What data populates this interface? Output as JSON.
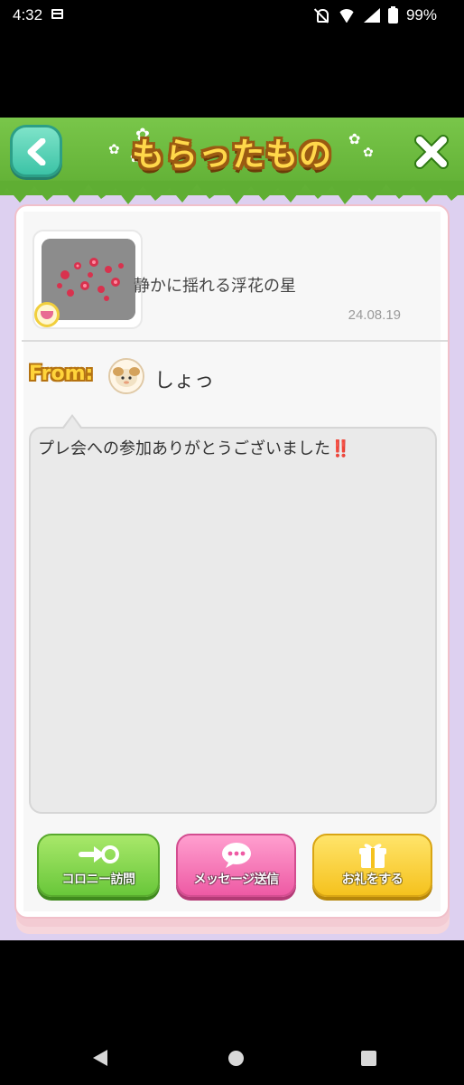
{
  "status_bar": {
    "time": "4:32",
    "battery": "99%",
    "icons": [
      "calendar-icon",
      "mute-icon",
      "wifi-icon",
      "signal-icon",
      "battery-icon"
    ]
  },
  "header": {
    "title": "もらったもの",
    "back_icon": "chevron-left-icon",
    "close_icon": "close-icon"
  },
  "gift": {
    "item_name": "静かに揺れる浮花の星",
    "date": "24.08.19",
    "from_label": "From:",
    "sender_name": "しょっ",
    "message": "プレ会への参加ありがとうございました",
    "message_mark": "‼️"
  },
  "buttons": {
    "visit_colony": "コロニー訪問",
    "send_message": "メッセージ送信",
    "thank": "お礼をする"
  },
  "colors": {
    "header_green": "#6cbc3e",
    "background_lavender": "#ddd0f0",
    "green_button": "#69c73a",
    "pink_button": "#ee5aa4",
    "yellow_button": "#f5c21e"
  },
  "nav_bar": [
    "back-icon",
    "home-icon",
    "recents-icon"
  ]
}
